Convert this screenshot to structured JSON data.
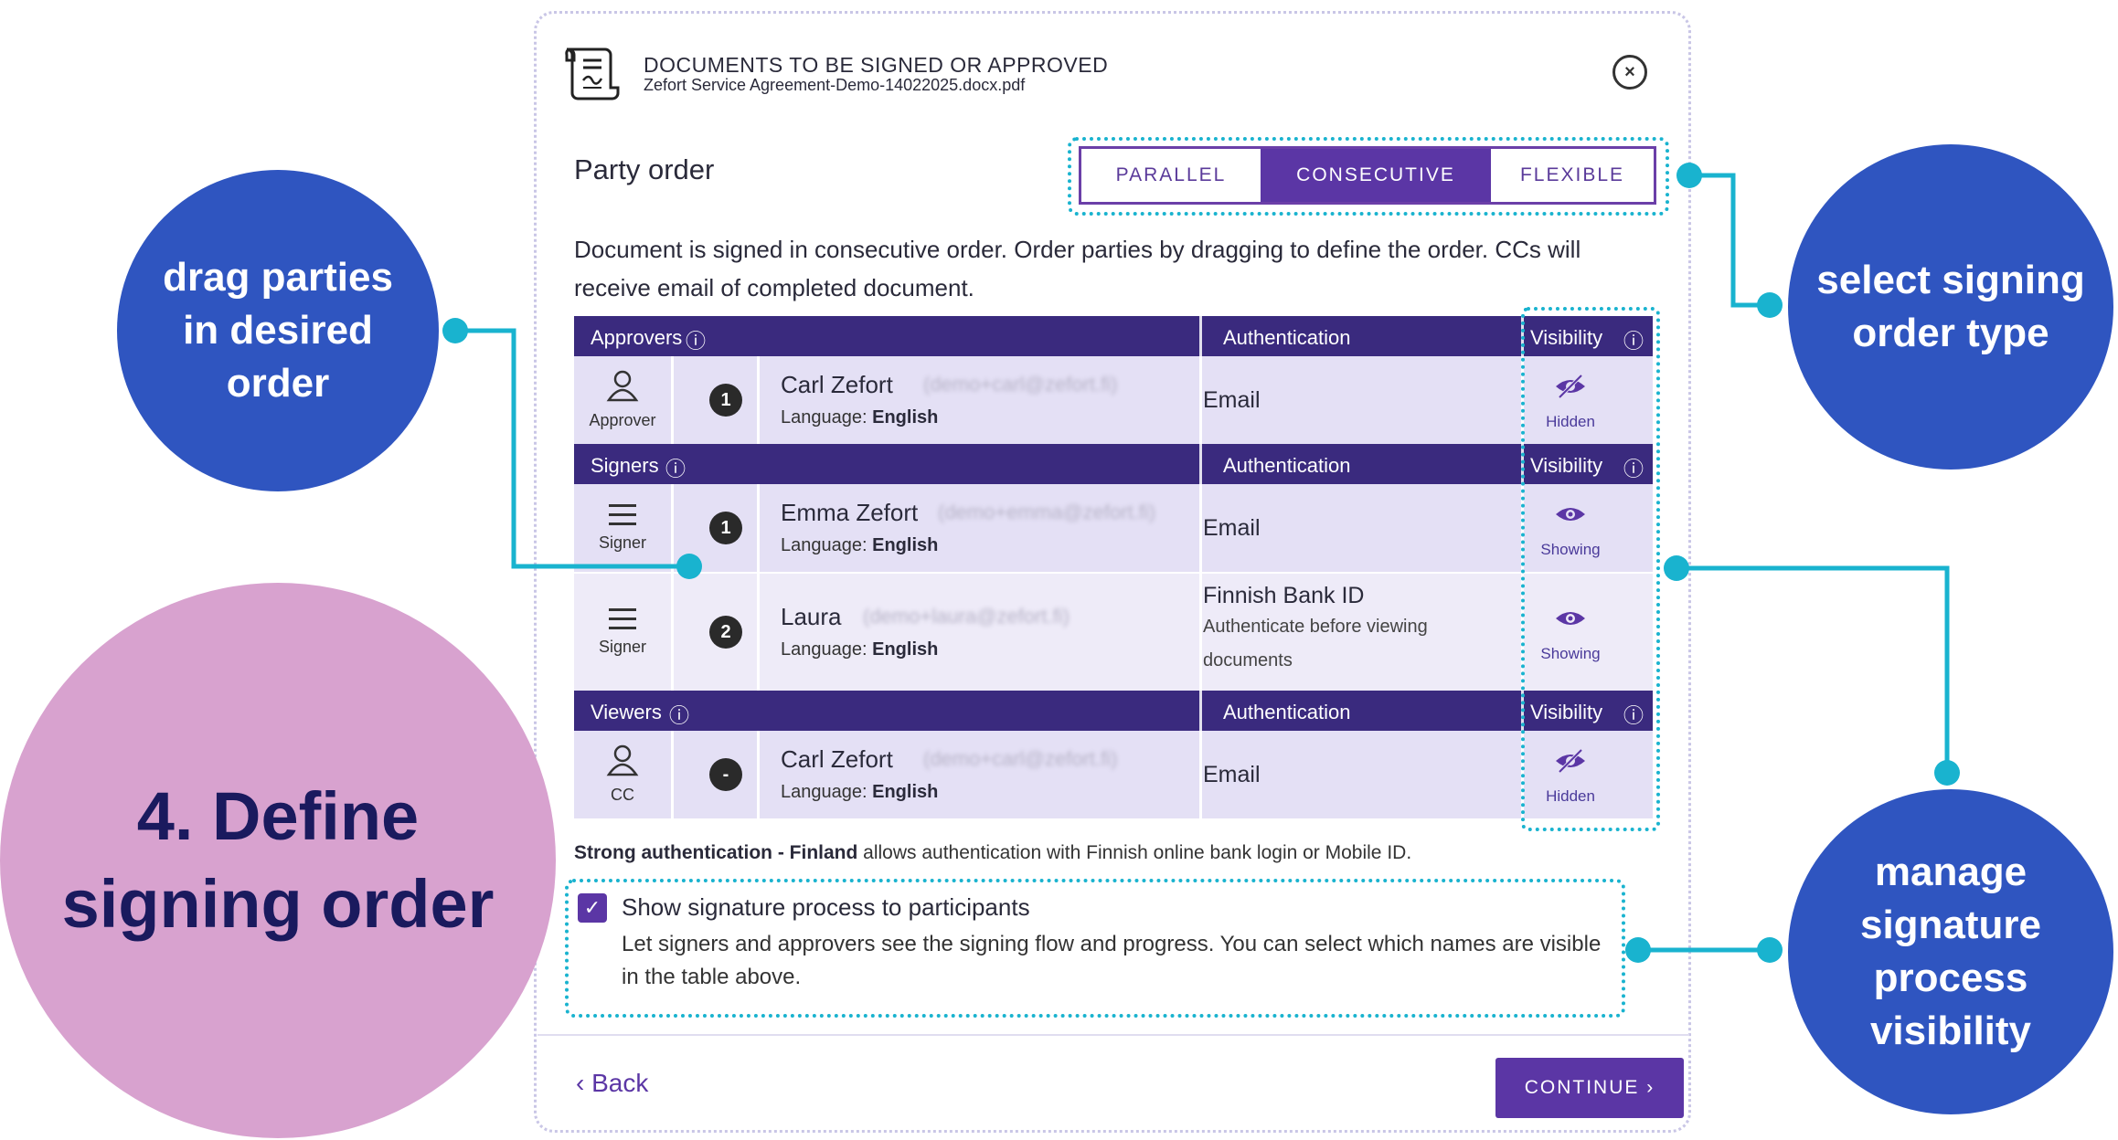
{
  "header": {
    "title": "DOCUMENTS TO BE SIGNED OR APPROVED",
    "filename": "Zefort Service Agreement-Demo-14022025.docx.pdf"
  },
  "party_order": {
    "title": "Party order",
    "options": [
      "PARALLEL",
      "CONSECUTIVE",
      "FLEXIBLE"
    ],
    "selected": "CONSECUTIVE",
    "description": "Document is signed in consecutive order. Order parties by dragging to define the order. CCs will receive email of completed document."
  },
  "table": {
    "auth_header": "Authentication",
    "visibility_header": "Visibility",
    "sections": [
      {
        "name": "Approvers",
        "rows": [
          {
            "role": "Approver",
            "order": "1",
            "name": "Carl Zefort",
            "email": "(demo+carl@zefort.fi)",
            "language_label": "Language:",
            "language": "English",
            "auth": "Email",
            "auth_note": "",
            "visibility": "Hidden"
          }
        ]
      },
      {
        "name": "Signers",
        "rows": [
          {
            "role": "Signer",
            "order": "1",
            "name": "Emma Zefort",
            "email": "(demo+emma@zefort.fi)",
            "language_label": "Language:",
            "language": "English",
            "auth": "Email",
            "auth_note": "",
            "visibility": "Showing"
          },
          {
            "role": "Signer",
            "order": "2",
            "name": "Laura",
            "email": "(demo+laura@zefort.fi)",
            "language_label": "Language:",
            "language": "English",
            "auth": "Finnish Bank ID",
            "auth_note": "Authenticate before viewing documents",
            "visibility": "Showing"
          }
        ]
      },
      {
        "name": "Viewers",
        "rows": [
          {
            "role": "CC",
            "order": "-",
            "name": "Carl Zefort",
            "email": "(demo+carl@zefort.fi)",
            "language_label": "Language:",
            "language": "English",
            "auth": "Email",
            "auth_note": "",
            "visibility": "Hidden"
          }
        ]
      }
    ]
  },
  "strong_auth": {
    "bold": "Strong authentication - Finland",
    "rest": " allows authentication with Finnish online bank login or Mobile ID."
  },
  "show_process": {
    "checked": true,
    "title": "Show signature process to participants",
    "description": "Let signers and approvers see the signing flow and progress. You can select which names are visible in the table above."
  },
  "footer": {
    "back_label": "Back",
    "continue_label": "CONTINUE"
  },
  "annotations": {
    "drag": "drag parties in desired order",
    "select": "select signing order type",
    "manage": "manage signature process visibility",
    "step": "4. Define signing order"
  },
  "colors": {
    "primary": "#5b36a5",
    "table_header": "#3a2a7e",
    "row_bg": "#e4e0f5",
    "highlight": "#19b3cf",
    "bubble_blue": "#2f55c0",
    "bubble_pink": "#d8a2cf"
  }
}
